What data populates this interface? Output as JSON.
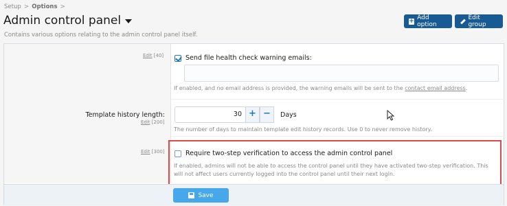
{
  "breadcrumb": {
    "items": [
      "Setup",
      "Options"
    ],
    "separator": ">"
  },
  "page": {
    "title": "Admin control panel",
    "description": "Contains various options relating to the admin control panel itself."
  },
  "toolbar": {
    "add_option_label": "Add option",
    "edit_group_label": "Edit group"
  },
  "options": [
    {
      "edit_label": "Edit",
      "order": "[40]",
      "checked": true,
      "label": "Send file health check warning emails:",
      "input_value": "",
      "hint_prefix": "If enabled, and no email address is provided, the warning emails will be sent to the",
      "hint_link": "contact email address",
      "hint_suffix": "."
    },
    {
      "label": "Template history length:",
      "edit_label": "Edit",
      "order": "[200]",
      "value": "30",
      "unit": "Days",
      "plus": "+",
      "minus": "−",
      "hint": "The number of days to maintain template edit history records. Use 0 to never remove history."
    },
    {
      "edit_label": "Edit",
      "order": "[300]",
      "checked": false,
      "label": "Require two-step verification to access the admin control panel",
      "hint": "If enabled, admins will not be able to access the control panel until they have activated two-step verification. This will not affect users currently logged into the control panel until their next login."
    }
  ],
  "footer": {
    "save_label": "Save"
  },
  "colors": {
    "primary": "#185b94",
    "save": "#47a7eb",
    "highlight": "#d94b4b"
  }
}
